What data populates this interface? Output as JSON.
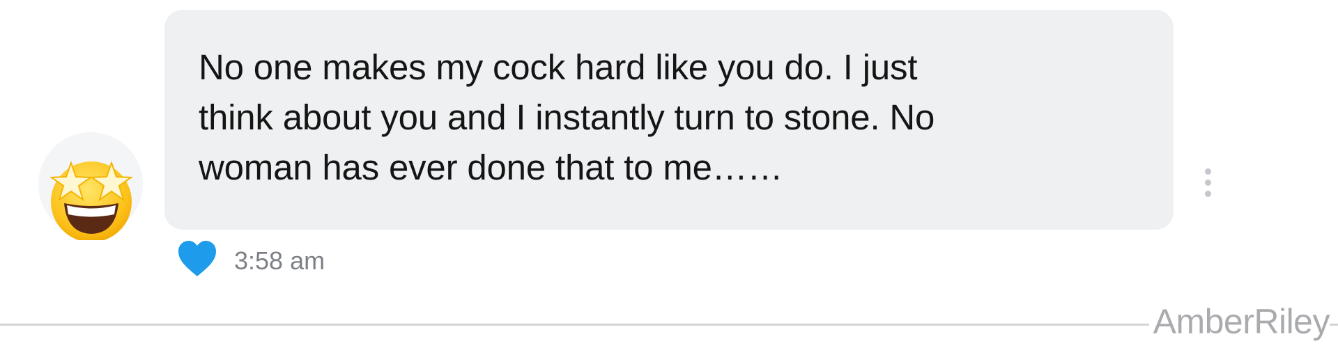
{
  "message": {
    "lines": [
      "No one makes my cock hard like you do. I just",
      "think about you and I instantly turn to stone. No",
      "woman has ever done that to me……"
    ],
    "timestamp": "3:58 am"
  },
  "sender": {
    "avatar_icon": "star-struck-emoji-icon"
  },
  "actions": {
    "like_icon": "heart-icon",
    "like_color": "#1e9bea",
    "more_icon": "vertical-dots-icon"
  },
  "watermark": "AmberRiley",
  "colors": {
    "bubble": "#eef0f2",
    "text": "#151515",
    "timestamp": "#7d8086",
    "divider": "#d2d4d7"
  }
}
